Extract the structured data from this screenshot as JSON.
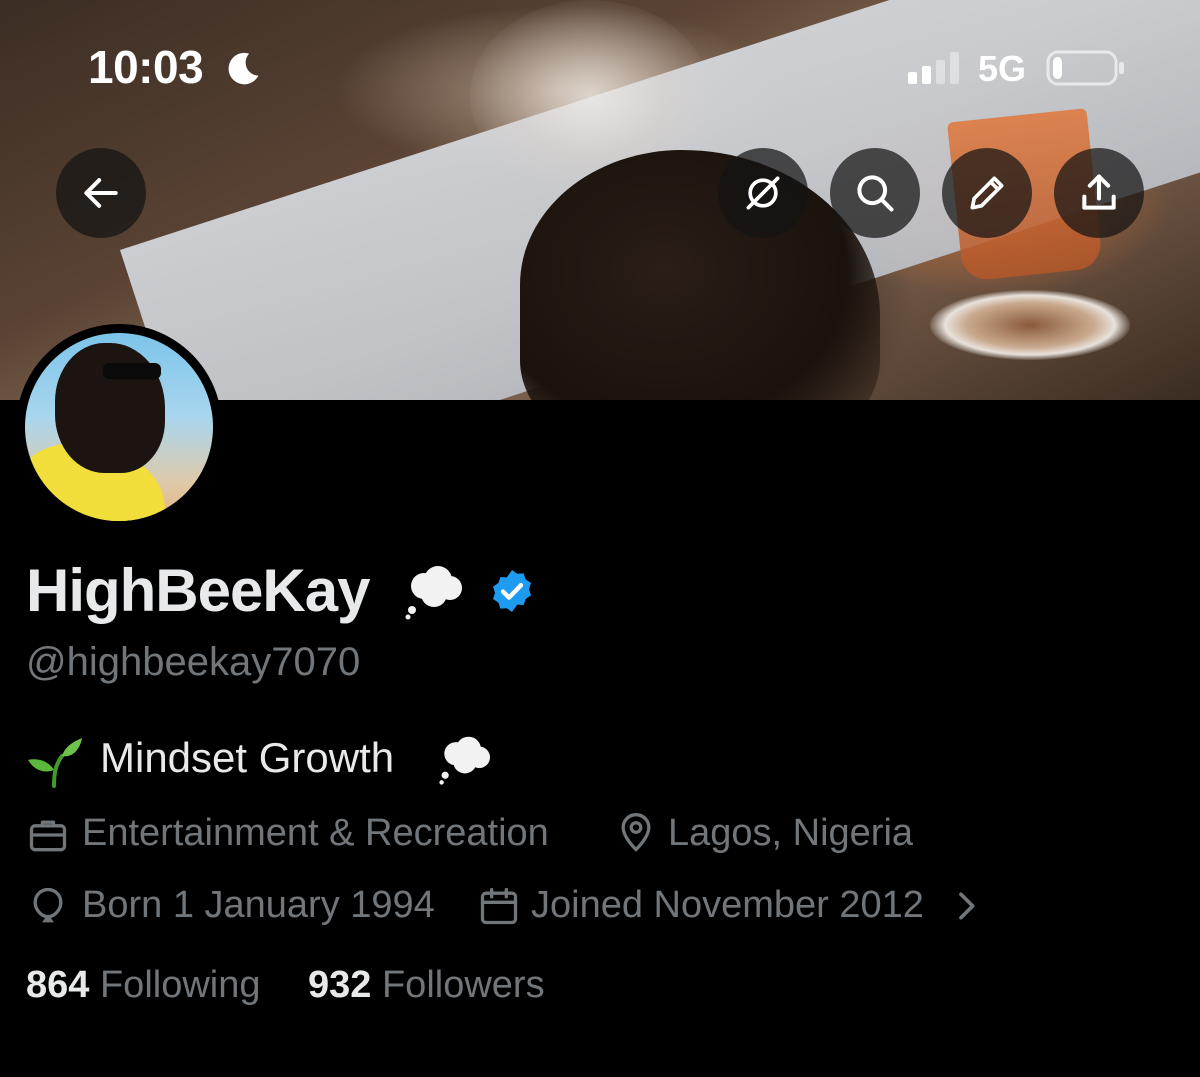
{
  "status_bar": {
    "time": "10:03",
    "focus_icon": "moon-icon",
    "network": "5G",
    "battery_level": 0.15
  },
  "header_actions": {
    "back": "back-arrow-icon",
    "grok": "grok-icon",
    "search": "search-icon",
    "edit": "pencil-icon",
    "share": "share-icon"
  },
  "profile": {
    "display_name": "HighBeeKay",
    "name_emoji": "thought-balloon-icon",
    "verified": true,
    "verified_color": "#1d9bf0",
    "handle": "@highbeekay7070",
    "bio": {
      "emoji_start": "seedling-icon",
      "text": "Mindset Growth",
      "emoji_end": "thought-balloon-icon"
    },
    "category": "Entertainment & Recreation",
    "location": "Lagos, Nigeria",
    "birthday": "Born 1 January 1994",
    "joined": "Joined November 2012"
  },
  "stats": {
    "following_count": "864",
    "following_label": "Following",
    "followers_count": "932",
    "followers_label": "Followers"
  },
  "colors": {
    "background": "#000000",
    "primary_text": "#e7e9ea",
    "secondary_text": "#71767b",
    "accent": "#1d9bf0"
  }
}
